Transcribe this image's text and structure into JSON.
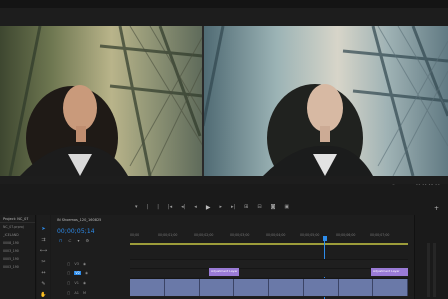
{
  "menu_bar": {
    "items": [
      "",
      "",
      "",
      "",
      "",
      "",
      "",
      "",
      "",
      "",
      "",
      ""
    ]
  },
  "program_monitor": {
    "timecode": "00;01;12;00",
    "controls": [
      "",
      "",
      ""
    ]
  },
  "transport": {
    "buttons": [
      "▾",
      "|",
      "|",
      "|◂",
      "◂|",
      "◂",
      "▶",
      "▸",
      "▸|",
      "⊞",
      "⊟",
      "◙",
      "▣"
    ],
    "add_button": "+"
  },
  "project_panel": {
    "title": "Project: NC_07",
    "rows": [
      "NC_07.prproj",
      "",
      "_ICELAND",
      "",
      "0008_190",
      "",
      "0003_190",
      "",
      "0005_190",
      "",
      "0003_190",
      ""
    ]
  },
  "timeline": {
    "tab_label": "IN Shoemos_120_160825",
    "timecode": "00;00;05;14",
    "ruler_labels": [
      "00;00",
      "00;00;01;00",
      "00;00;02;00",
      "00;00;03;00",
      "00;00;04;00",
      "00;00;05;00",
      "00;00;06;00",
      "00;00;07;00"
    ],
    "tracks": [
      {
        "name": "V3",
        "clip": ""
      },
      {
        "name": "V2",
        "clip": "Adjustment Layer"
      },
      {
        "name": "V1",
        "clip": ""
      },
      {
        "name": "A1",
        "clip": ""
      }
    ],
    "clips": {
      "adjustment_1": "Adjustment Layer",
      "adjustment_2": "Adjustment Layer"
    }
  },
  "colors": {
    "accent": "#2d8ceb",
    "clip_purple": "#9a7bd6",
    "clip_video": "#6a79a8",
    "work_area": "#9c9c3a"
  }
}
